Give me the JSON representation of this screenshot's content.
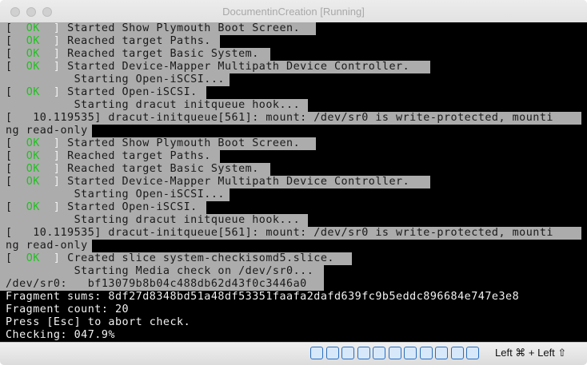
{
  "window": {
    "title": "DocumentinCreation [Running]"
  },
  "console": {
    "ok_label": "OK",
    "lines": [
      {
        "kind": "ok",
        "text": "Started Show Plymouth Boot Screen."
      },
      {
        "kind": "ok",
        "text": "Reached target Paths."
      },
      {
        "kind": "ok",
        "text": "Reached target Basic System."
      },
      {
        "kind": "ok",
        "text": "Started Device-Mapper Multipath Device Controller."
      },
      {
        "kind": "indent",
        "text": "Starting Open-iSCSI..."
      },
      {
        "kind": "ok",
        "text": "Started Open-iSCSI."
      },
      {
        "kind": "indent",
        "text": "Starting dracut initqueue hook..."
      },
      {
        "kind": "plain",
        "text": "[   10.119535] dracut-initqueue[561]: mount: /dev/sr0 is write-protected, mounti"
      },
      {
        "kind": "plain",
        "text": "ng read-only"
      },
      {
        "kind": "ok",
        "text": "Started Show Plymouth Boot Screen."
      },
      {
        "kind": "ok",
        "text": "Reached target Paths."
      },
      {
        "kind": "ok",
        "text": "Reached target Basic System."
      },
      {
        "kind": "ok",
        "text": "Started Device-Mapper Multipath Device Controller."
      },
      {
        "kind": "indent",
        "text": "Starting Open-iSCSI..."
      },
      {
        "kind": "ok",
        "text": "Started Open-iSCSI."
      },
      {
        "kind": "indent",
        "text": "Starting dracut initqueue hook..."
      },
      {
        "kind": "plain",
        "text": "[   10.119535] dracut-initqueue[561]: mount: /dev/sr0 is write-protected, mounti"
      },
      {
        "kind": "plain",
        "text": "ng read-only"
      },
      {
        "kind": "ok",
        "text": "Created slice system-checkisomd5.slice."
      },
      {
        "kind": "indent",
        "text": "Starting Media check on /dev/sr0..."
      },
      {
        "kind": "plain",
        "text": "/dev/sr0:   bf13079b8b04c488db62d43f0c3446a0"
      },
      {
        "kind": "plain",
        "text": "Fragment sums: 8df27d8348bd51a48df53351faafa2dafd639fc9b5eddc896684e747e3e8"
      },
      {
        "kind": "plain",
        "text": "Fragment count: 20"
      },
      {
        "kind": "plain",
        "text": "Press [Esc] to abort check."
      },
      {
        "kind": "plain",
        "text": "Checking: 047.9%"
      }
    ]
  },
  "statusbar": {
    "host_key": "Left ⌘ + Left ⇧",
    "icons": [
      "optical-disk-icon",
      "audio-icon",
      "network-icon",
      "usb-icon",
      "pencil-icon",
      "shared-folder-icon",
      "display-icon",
      "video-capture-icon",
      "cpu-icon",
      "mouse-integration-icon",
      "arrow-down-icon"
    ]
  },
  "colors": {
    "console_bg": "#000000",
    "highlight_bg": "#acacac",
    "ok_green": "#21c121"
  }
}
